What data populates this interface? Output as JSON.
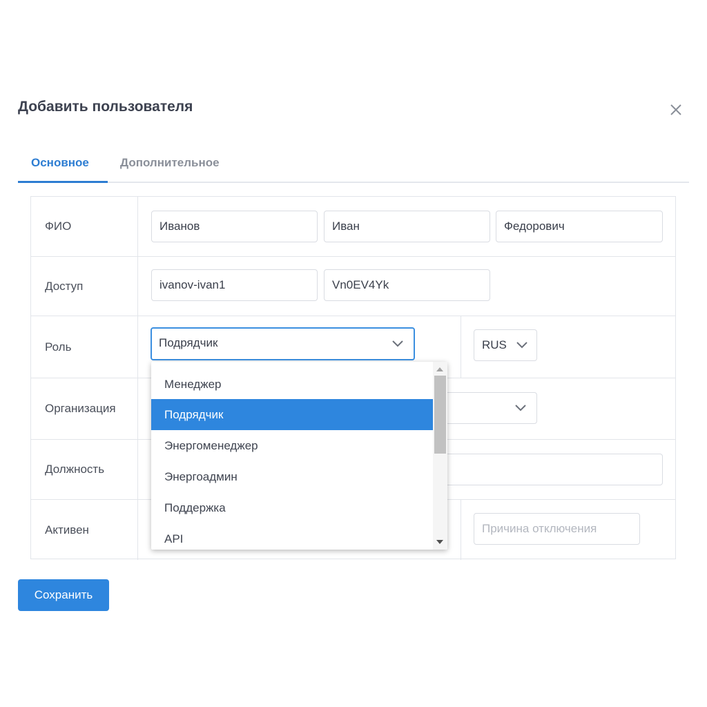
{
  "modal": {
    "title": "Добавить пользователя"
  },
  "tabs": [
    {
      "label": "Основное",
      "active": true
    },
    {
      "label": "Дополнительное",
      "active": false
    }
  ],
  "form": {
    "fio": {
      "label": "ФИО",
      "last_name": "Иванов",
      "first_name": "Иван",
      "middle_name": "Федорович"
    },
    "access": {
      "label": "Доступ",
      "login": "ivanov-ivan1",
      "password": "Vn0EV4Yk"
    },
    "role": {
      "label": "Роль",
      "selected": "Подрядчик",
      "language": "RUS",
      "options": [
        "Менеджер",
        "Подрядчик",
        "Энергоменеджер",
        "Энергоадмин",
        "Поддержка",
        "API"
      ]
    },
    "organization": {
      "label": "Организация"
    },
    "position": {
      "label": "Должность"
    },
    "active": {
      "label": "Активен",
      "reason_placeholder": "Причина отключения"
    }
  },
  "actions": {
    "save_label": "Сохранить"
  },
  "colors": {
    "accent": "#2e86de",
    "focus_border": "#3b8fe0",
    "border": "#e2e5ea"
  }
}
